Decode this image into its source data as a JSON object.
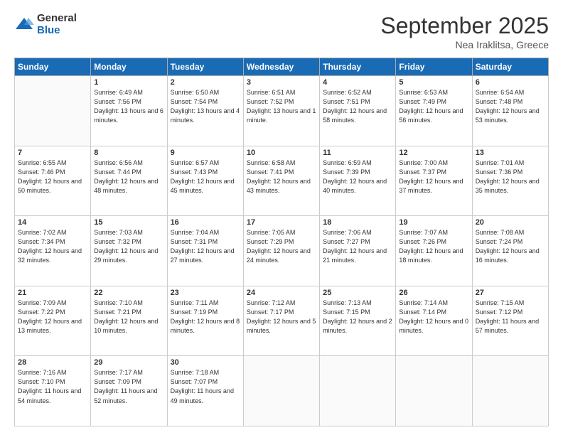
{
  "logo": {
    "general": "General",
    "blue": "Blue"
  },
  "header": {
    "title": "September 2025",
    "location": "Nea Iraklitsa, Greece"
  },
  "columns": [
    "Sunday",
    "Monday",
    "Tuesday",
    "Wednesday",
    "Thursday",
    "Friday",
    "Saturday"
  ],
  "weeks": [
    [
      {
        "day": "",
        "sunrise": "",
        "sunset": "",
        "daylight": "",
        "empty": true
      },
      {
        "day": "1",
        "sunrise": "Sunrise: 6:49 AM",
        "sunset": "Sunset: 7:56 PM",
        "daylight": "Daylight: 13 hours and 6 minutes."
      },
      {
        "day": "2",
        "sunrise": "Sunrise: 6:50 AM",
        "sunset": "Sunset: 7:54 PM",
        "daylight": "Daylight: 13 hours and 4 minutes."
      },
      {
        "day": "3",
        "sunrise": "Sunrise: 6:51 AM",
        "sunset": "Sunset: 7:52 PM",
        "daylight": "Daylight: 13 hours and 1 minute."
      },
      {
        "day": "4",
        "sunrise": "Sunrise: 6:52 AM",
        "sunset": "Sunset: 7:51 PM",
        "daylight": "Daylight: 12 hours and 58 minutes."
      },
      {
        "day": "5",
        "sunrise": "Sunrise: 6:53 AM",
        "sunset": "Sunset: 7:49 PM",
        "daylight": "Daylight: 12 hours and 56 minutes."
      },
      {
        "day": "6",
        "sunrise": "Sunrise: 6:54 AM",
        "sunset": "Sunset: 7:48 PM",
        "daylight": "Daylight: 12 hours and 53 minutes."
      }
    ],
    [
      {
        "day": "7",
        "sunrise": "Sunrise: 6:55 AM",
        "sunset": "Sunset: 7:46 PM",
        "daylight": "Daylight: 12 hours and 50 minutes."
      },
      {
        "day": "8",
        "sunrise": "Sunrise: 6:56 AM",
        "sunset": "Sunset: 7:44 PM",
        "daylight": "Daylight: 12 hours and 48 minutes."
      },
      {
        "day": "9",
        "sunrise": "Sunrise: 6:57 AM",
        "sunset": "Sunset: 7:43 PM",
        "daylight": "Daylight: 12 hours and 45 minutes."
      },
      {
        "day": "10",
        "sunrise": "Sunrise: 6:58 AM",
        "sunset": "Sunset: 7:41 PM",
        "daylight": "Daylight: 12 hours and 43 minutes."
      },
      {
        "day": "11",
        "sunrise": "Sunrise: 6:59 AM",
        "sunset": "Sunset: 7:39 PM",
        "daylight": "Daylight: 12 hours and 40 minutes."
      },
      {
        "day": "12",
        "sunrise": "Sunrise: 7:00 AM",
        "sunset": "Sunset: 7:37 PM",
        "daylight": "Daylight: 12 hours and 37 minutes."
      },
      {
        "day": "13",
        "sunrise": "Sunrise: 7:01 AM",
        "sunset": "Sunset: 7:36 PM",
        "daylight": "Daylight: 12 hours and 35 minutes."
      }
    ],
    [
      {
        "day": "14",
        "sunrise": "Sunrise: 7:02 AM",
        "sunset": "Sunset: 7:34 PM",
        "daylight": "Daylight: 12 hours and 32 minutes."
      },
      {
        "day": "15",
        "sunrise": "Sunrise: 7:03 AM",
        "sunset": "Sunset: 7:32 PM",
        "daylight": "Daylight: 12 hours and 29 minutes."
      },
      {
        "day": "16",
        "sunrise": "Sunrise: 7:04 AM",
        "sunset": "Sunset: 7:31 PM",
        "daylight": "Daylight: 12 hours and 27 minutes."
      },
      {
        "day": "17",
        "sunrise": "Sunrise: 7:05 AM",
        "sunset": "Sunset: 7:29 PM",
        "daylight": "Daylight: 12 hours and 24 minutes."
      },
      {
        "day": "18",
        "sunrise": "Sunrise: 7:06 AM",
        "sunset": "Sunset: 7:27 PM",
        "daylight": "Daylight: 12 hours and 21 minutes."
      },
      {
        "day": "19",
        "sunrise": "Sunrise: 7:07 AM",
        "sunset": "Sunset: 7:26 PM",
        "daylight": "Daylight: 12 hours and 18 minutes."
      },
      {
        "day": "20",
        "sunrise": "Sunrise: 7:08 AM",
        "sunset": "Sunset: 7:24 PM",
        "daylight": "Daylight: 12 hours and 16 minutes."
      }
    ],
    [
      {
        "day": "21",
        "sunrise": "Sunrise: 7:09 AM",
        "sunset": "Sunset: 7:22 PM",
        "daylight": "Daylight: 12 hours and 13 minutes."
      },
      {
        "day": "22",
        "sunrise": "Sunrise: 7:10 AM",
        "sunset": "Sunset: 7:21 PM",
        "daylight": "Daylight: 12 hours and 10 minutes."
      },
      {
        "day": "23",
        "sunrise": "Sunrise: 7:11 AM",
        "sunset": "Sunset: 7:19 PM",
        "daylight": "Daylight: 12 hours and 8 minutes."
      },
      {
        "day": "24",
        "sunrise": "Sunrise: 7:12 AM",
        "sunset": "Sunset: 7:17 PM",
        "daylight": "Daylight: 12 hours and 5 minutes."
      },
      {
        "day": "25",
        "sunrise": "Sunrise: 7:13 AM",
        "sunset": "Sunset: 7:15 PM",
        "daylight": "Daylight: 12 hours and 2 minutes."
      },
      {
        "day": "26",
        "sunrise": "Sunrise: 7:14 AM",
        "sunset": "Sunset: 7:14 PM",
        "daylight": "Daylight: 12 hours and 0 minutes."
      },
      {
        "day": "27",
        "sunrise": "Sunrise: 7:15 AM",
        "sunset": "Sunset: 7:12 PM",
        "daylight": "Daylight: 11 hours and 57 minutes."
      }
    ],
    [
      {
        "day": "28",
        "sunrise": "Sunrise: 7:16 AM",
        "sunset": "Sunset: 7:10 PM",
        "daylight": "Daylight: 11 hours and 54 minutes."
      },
      {
        "day": "29",
        "sunrise": "Sunrise: 7:17 AM",
        "sunset": "Sunset: 7:09 PM",
        "daylight": "Daylight: 11 hours and 52 minutes."
      },
      {
        "day": "30",
        "sunrise": "Sunrise: 7:18 AM",
        "sunset": "Sunset: 7:07 PM",
        "daylight": "Daylight: 11 hours and 49 minutes."
      },
      {
        "day": "",
        "sunrise": "",
        "sunset": "",
        "daylight": "",
        "empty": true
      },
      {
        "day": "",
        "sunrise": "",
        "sunset": "",
        "daylight": "",
        "empty": true
      },
      {
        "day": "",
        "sunrise": "",
        "sunset": "",
        "daylight": "",
        "empty": true
      },
      {
        "day": "",
        "sunrise": "",
        "sunset": "",
        "daylight": "",
        "empty": true
      }
    ]
  ]
}
